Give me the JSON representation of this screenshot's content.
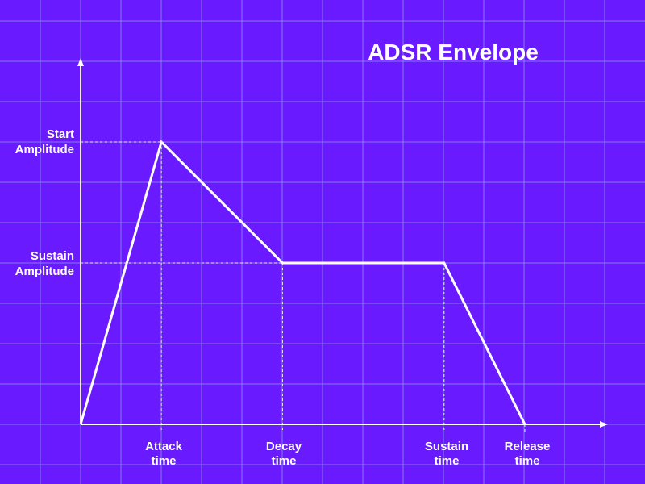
{
  "title": "ADSR Envelope",
  "colors": {
    "background": "#6a1aff",
    "grid": "#8a8cff",
    "foreground": "#ffffff"
  },
  "y_labels": {
    "start_amplitude": [
      "Start",
      "Amplitude"
    ],
    "sustain_amplitude": [
      "Sustain",
      "Amplitude"
    ]
  },
  "x_labels": {
    "attack_time": [
      "Attack",
      "time"
    ],
    "decay_time": [
      "Decay",
      "time"
    ],
    "sustain_time": [
      "Sustain",
      "time"
    ],
    "release_time": [
      "Release",
      "time"
    ]
  },
  "envelope": {
    "levels": {
      "start": 1.0,
      "sustain": 0.5714
    },
    "times": {
      "attack": 0.1818,
      "decay": 0.4545,
      "sustain": 0.8182,
      "release": 1.0
    }
  }
}
